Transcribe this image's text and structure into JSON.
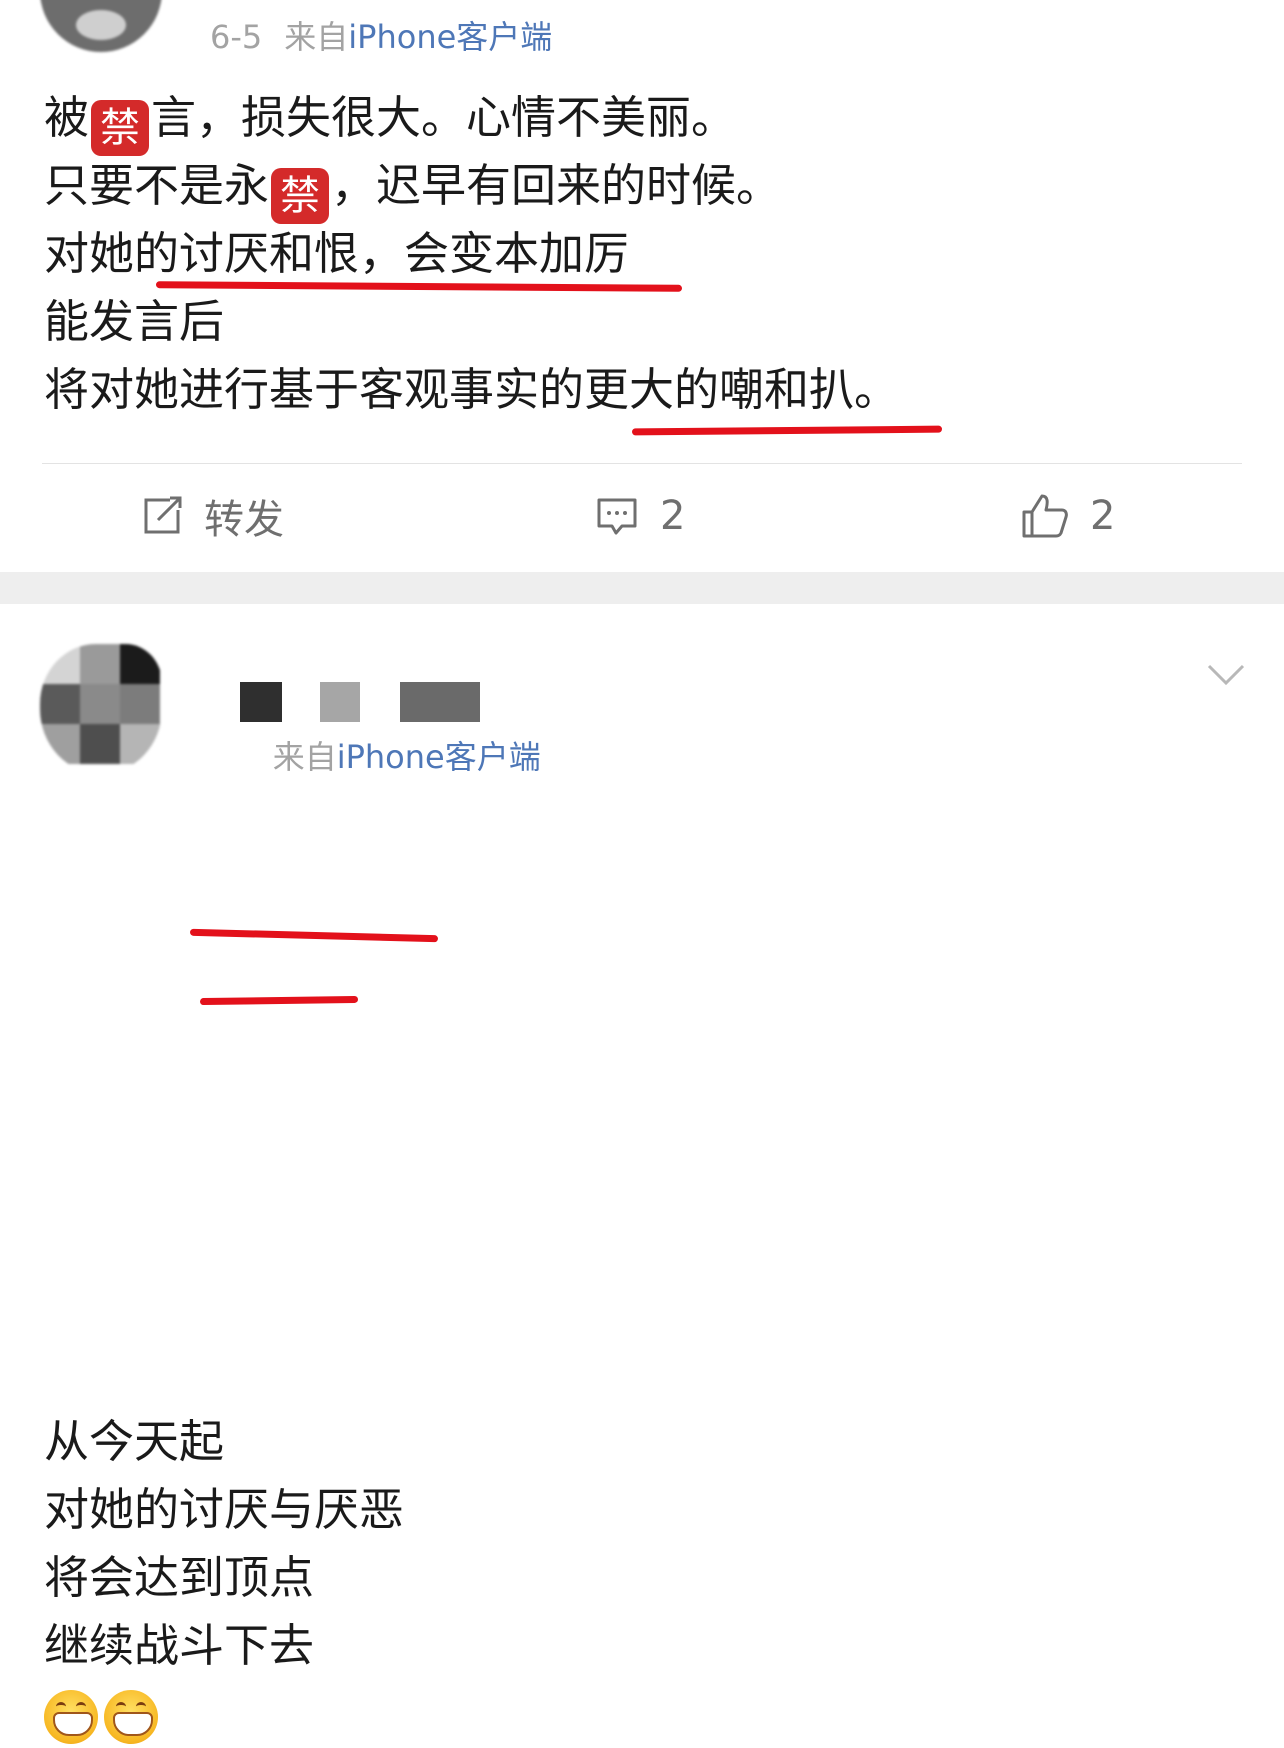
{
  "post1": {
    "date": "6-5",
    "source_prefix": "来自",
    "source_app": "iPhone客户端",
    "lines": [
      {
        "before": "被",
        "badge": "禁",
        "after": "言，损失很大。心情不美丽。"
      },
      {
        "before": "只要不是永",
        "badge": "禁",
        "after": "，迟早有回来的时候。"
      },
      {
        "text": "对她的讨厌和恨，会变本加厉"
      },
      {
        "text": "能发言后"
      },
      {
        "text": "将对她进行基于客观事实的更大的嘲和扒。"
      }
    ],
    "actions": {
      "repost_label": "转发",
      "comment_count": "2",
      "like_count": "2"
    }
  },
  "post2": {
    "source_prefix": "来自",
    "source_app": "iPhone客户端",
    "lines": [
      "从今天起",
      "对她的讨厌与厌恶",
      "将会达到顶点",
      "继续战斗下去"
    ],
    "emoji_count": 2
  },
  "colors": {
    "link": "#4e77b7",
    "meta_gray": "#a3a3a3",
    "underline_red": "#e3111b",
    "separator": "#eeeeee"
  },
  "icons": [
    "repost-icon",
    "comment-icon",
    "like-icon",
    "chevron-down-icon",
    "grin-emoji-icon"
  ]
}
